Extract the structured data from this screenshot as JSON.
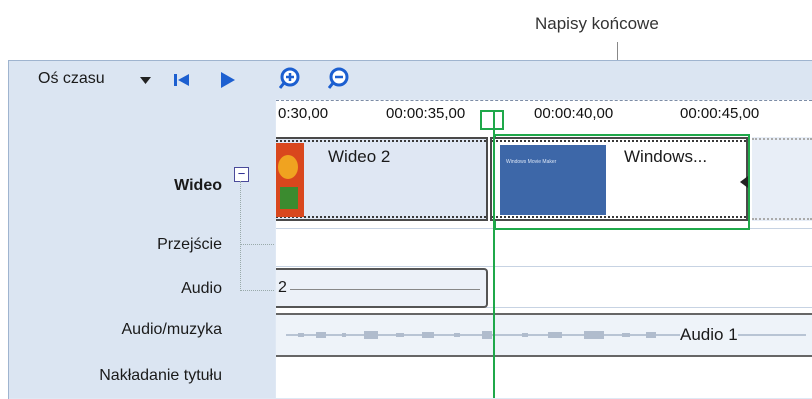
{
  "callout": {
    "text": "Napisy końcowe"
  },
  "toolbar": {
    "timeline_label": "Oś czasu",
    "dropdown_icon": "triangle-down-icon",
    "rewind_icon": "skip-start-icon",
    "play_icon": "play-icon",
    "zoom_in_icon": "zoom-in-icon",
    "zoom_out_icon": "zoom-out-icon"
  },
  "ruler": {
    "ticks": [
      "0:30,00",
      "00:00:35,00",
      "00:00:40,00",
      "00:00:45,00"
    ]
  },
  "tracks": {
    "video": {
      "label": "Wideo",
      "collapse_symbol": "−"
    },
    "transition": {
      "label": "Przejście"
    },
    "audio": {
      "label": "Audio"
    },
    "audio_music": {
      "label": "Audio/muzyka"
    },
    "title_overlay": {
      "label": "Nakładanie tytułu"
    }
  },
  "clips": {
    "video2": {
      "label": "Wideo 2"
    },
    "windows": {
      "label": "Windows...",
      "thumb_text": "Windows Movie Maker"
    },
    "audio_clip": {
      "label": "2"
    },
    "audio1": {
      "label": "Audio 1"
    }
  },
  "colors": {
    "playhead": "#1fa84a",
    "accent": "#1c5fd0",
    "thumb": "#3d67a8"
  }
}
